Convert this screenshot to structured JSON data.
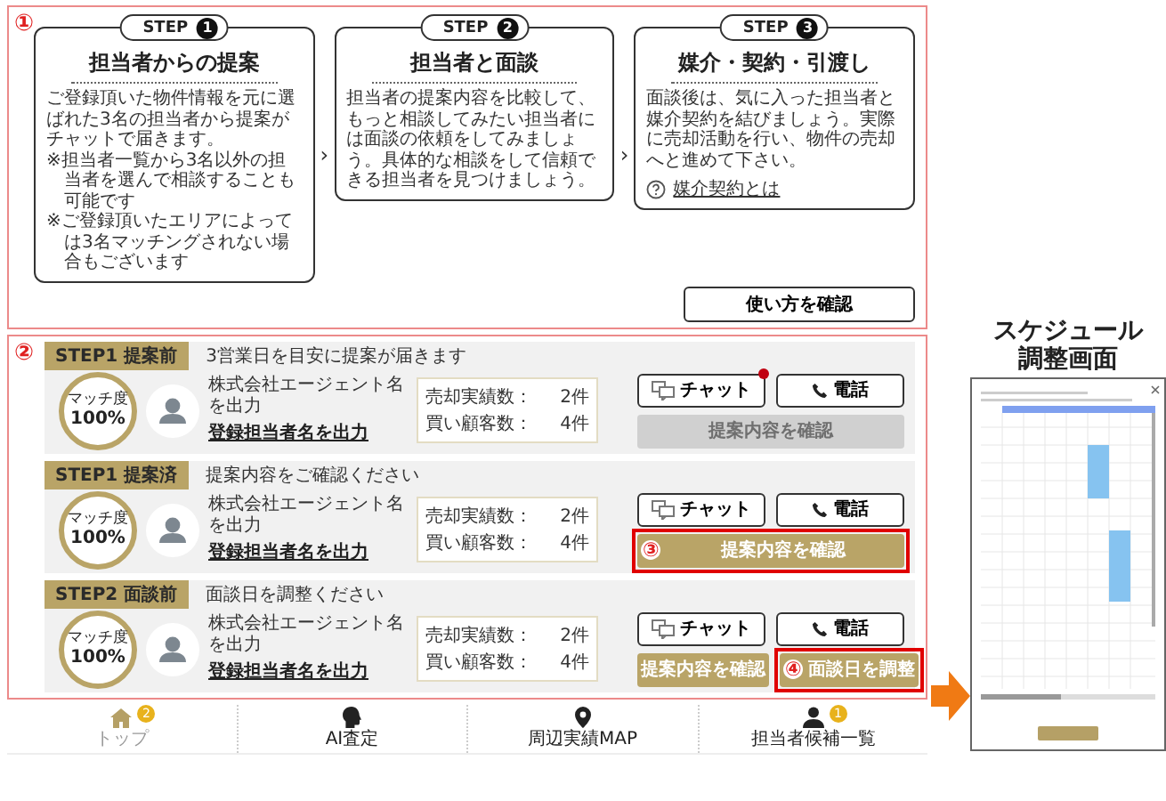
{
  "guide": {
    "marker": "①",
    "steps": [
      {
        "label": "STEP",
        "number": "1",
        "title": "担当者からの提案",
        "body": "ご登録頂いた物件情報を元に選ばれた3名の担当者から提案がチャットで届きます。",
        "notes": [
          "※担当者一覧から3名以外の担当者を選んで相談することも可能です",
          "※ご登録頂いたエリアによっては3名マッチングされない場合もございます"
        ]
      },
      {
        "arrow": "›",
        "label": "STEP",
        "number": "2",
        "title": "担当者と面談",
        "body": "担当者の提案内容を比較して、もっと相談してみたい担当者には面談の依頼をしてみましょう。具体的な相談をして信頼できる担当者を見つけましょう。"
      },
      {
        "arrow": "›",
        "label": "STEP",
        "number": "3",
        "title": "媒介・契約・引渡し",
        "body": "面談後は、気に入った担当者と媒介契約を結びましょう。実際に売却活動を行い、物件の売却へと進めて下さい。",
        "link": "媒介契約とは"
      }
    ],
    "help_button": "使い方を確認"
  },
  "agents": {
    "marker": "②",
    "rows": [
      {
        "status": "STEP1 提案前",
        "message": "3営業日を目安に提案が届きます",
        "match_label": "マッチ度",
        "match_value": "100%",
        "company": "株式会社エージェント名を出力",
        "name": "登録担当者名を出力",
        "stats": [
          {
            "label": "売却実績数：",
            "value": "2件"
          },
          {
            "label": "買い顧客数：",
            "value": "4件"
          }
        ],
        "chat": {
          "label": "チャット",
          "unread": true
        },
        "phone": "電話",
        "actions": [
          {
            "label": "提案内容を確認",
            "disabled": true
          }
        ]
      },
      {
        "status": "STEP1 提案済",
        "message": "提案内容をご確認ください",
        "match_label": "マッチ度",
        "match_value": "100%",
        "company": "株式会社エージェント名を出力",
        "name": "登録担当者名を出力",
        "stats": [
          {
            "label": "売却実績数：",
            "value": "2件"
          },
          {
            "label": "買い顧客数：",
            "value": "4件"
          }
        ],
        "chat": {
          "label": "チャット",
          "unread": false
        },
        "phone": "電話",
        "actions": [
          {
            "label": "提案内容を確認",
            "disabled": false,
            "annotation": "③"
          }
        ]
      },
      {
        "status": "STEP2 面談前",
        "message": "面談日を調整ください",
        "match_label": "マッチ度",
        "match_value": "100%",
        "company": "株式会社エージェント名を出力",
        "name": "登録担当者名を出力",
        "stats": [
          {
            "label": "売却実績数：",
            "value": "2件"
          },
          {
            "label": "買い顧客数：",
            "value": "4件"
          }
        ],
        "chat": {
          "label": "チャット",
          "unread": false
        },
        "phone": "電話",
        "actions": [
          {
            "label": "提案内容を確認",
            "disabled": false
          },
          {
            "label": "面談日を調整",
            "disabled": false,
            "annotation": "④"
          }
        ]
      }
    ]
  },
  "bottom_nav": [
    {
      "kind": "home",
      "label": "トップ",
      "selected": true,
      "badge": "2"
    },
    {
      "kind": "ai",
      "label": "AI査定",
      "selected": false
    },
    {
      "kind": "map",
      "label": "周辺実績MAP",
      "selected": false
    },
    {
      "kind": "person",
      "label": "担当者候補一覧",
      "selected": false,
      "badge": "1"
    }
  ],
  "schedule_preview": {
    "title_lines": [
      "スケジュール",
      "調整画面"
    ]
  }
}
